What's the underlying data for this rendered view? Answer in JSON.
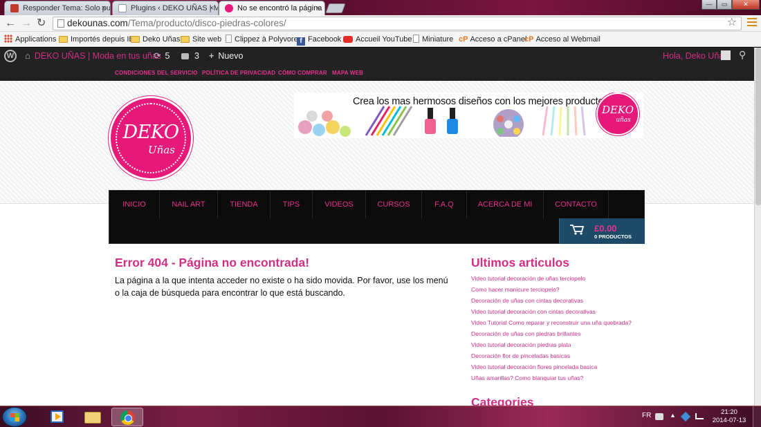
{
  "browser": {
    "tabs": [
      {
        "title": "Responder Tema: Solo pu",
        "active": false
      },
      {
        "title": "Plugins ‹ DEKO UÑAS | Mo",
        "active": false
      },
      {
        "title": "No se encontró la página",
        "active": true
      }
    ],
    "tab_close": "×",
    "window_controls": {
      "minimize": "—",
      "maximize": "▭",
      "close": "✕"
    },
    "nav": {
      "back": "←",
      "forward": "→",
      "reload": "↻"
    },
    "url": {
      "domain": "dekounas.com",
      "path": "/Tema/producto/disco-piedras-colores/"
    },
    "star": "☆",
    "bookmarks": [
      {
        "label": "Applications",
        "icon": "apps-grid-icon"
      },
      {
        "label": "Importés depuis IE",
        "icon": "folder-icon"
      },
      {
        "label": "Deko Uñas",
        "icon": "folder-icon"
      },
      {
        "label": "Site web",
        "icon": "folder-icon"
      },
      {
        "label": "Clippez à Polyvore",
        "icon": "page-icon"
      },
      {
        "label": "Facebook",
        "icon": "facebook-icon"
      },
      {
        "label": "Accueil YouTube",
        "icon": "youtube-icon"
      },
      {
        "label": "Miniature",
        "icon": "page-icon"
      },
      {
        "label": "Acceso a cPanel",
        "icon": "cpanel-icon"
      },
      {
        "label": "Acceso al Webmail",
        "icon": "cpanel-icon"
      }
    ]
  },
  "admin_bar": {
    "site_name": "DEKO UÑAS | Moda en tus uñas",
    "updates_count": "5",
    "comments_count": "3",
    "new_label": "Nuevo",
    "howdy": "Hola, Deko Uñas"
  },
  "site": {
    "top_links": [
      "CONDICIONES DEL SERVICIO",
      "POLÍTICA DE PRIVACIDAD",
      "CÓMO COMPRAR",
      "MAPA WEB"
    ],
    "logo": {
      "line1": "DEKO",
      "line2": "Uñas"
    },
    "banner": {
      "text": "Crea los mas hermosos diseños con los mejores productos",
      "badge_line1": "DEKO",
      "badge_line2": "uñas"
    },
    "nav": [
      "INICIO",
      "NAIL ART",
      "TIENDA",
      "TIPS",
      "VIDEOS",
      "CURSOS",
      "F.A.Q",
      "ACERCA DE MI",
      "CONTACTO"
    ],
    "cart": {
      "amount": "£0.00",
      "count": "0 PRODUCTOS"
    },
    "error_title": "Error 404 - Página no encontrada!",
    "error_text": "La página a la que intenta acceder no existe o ha sido movida. Por favor, use los menú o la caja de búsqueda para encontrar lo que está buscando.",
    "sidebar_title": "Ultimos articulos",
    "sidebar_articles": [
      "Video tutorial decoración de uñas terciopelo",
      "Como hacer manicure terciopelo?",
      "Decoración de uñas con cintas decorativas",
      "Video tutorial decoración con cintas decorativas",
      "Video Tutorial Como reparar y reconstruir una uña quebrada?",
      "Decoración de uñas con piedras brillantes",
      "Video tutorial decoración piedras plata",
      "Decoración flor de pinceladas basicas",
      "Video tutorial decoración flores pincelada basica",
      "Uñas amarillas? Como blanquiar tus uñas?"
    ],
    "sidebar_title2": "Categories"
  },
  "taskbar": {
    "language": "FR",
    "time": "21:20",
    "date": "2014-07-13"
  },
  "colors": {
    "brand_pink": "#e6187a",
    "link_pink": "#d12f85",
    "admin_bar": "#222222"
  }
}
